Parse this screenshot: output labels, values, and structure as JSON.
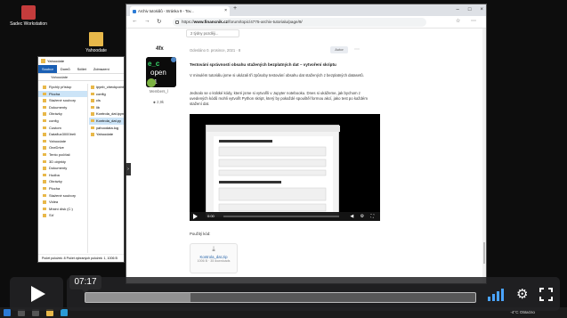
{
  "desktop": {
    "icons": [
      {
        "label": "Sadec Workstation",
        "color": "#c43c3c"
      },
      {
        "label": "Yahoodate",
        "color": "#e8b84a"
      }
    ]
  },
  "explorer": {
    "title": "Yahoodate",
    "ribbon": [
      "Soubor",
      "Domů",
      "Sdílet",
      "Zobrazení"
    ],
    "active_ribbon": "Soubor",
    "address": "Yahoodate",
    "nav": [
      "Rychlý přístup",
      "Plocha",
      "Stažené soubory",
      "Dokumenty",
      "Obrázky",
      "config",
      "Custom",
      "Dataflux3000Ireli",
      "Yahoodate",
      "OneDrive",
      "Tento počítač",
      "3D objekty",
      "Dokumenty",
      "Hudba",
      "Obrázky",
      "Plocha",
      "Stažené soubory",
      "Videa",
      "Místní disk (C:)",
      "Síť"
    ],
    "nav_selected": "Plocha",
    "files": [
      "ipynb_checkpoints",
      "config",
      "cls",
      "lib",
      "Kontrola_dat.ipynb",
      "Kontrola_dat.py",
      "yahoodata.log",
      "Yahoodate"
    ],
    "file_selected": "Kontrola_dat.py",
    "status": "Počet položek: 8   Počet vybraných položek: 1, 1006 B"
  },
  "browser": {
    "tab_title": "Archiv tutoriálů - Stránka 9 - Tov...",
    "url_prefix": "https://",
    "url_domain": "www.financnik.cz",
    "url_rest": "/forum/topic/4775-archiv-tutorialu/page/9/",
    "prev_box": "2 týdny později...",
    "post": {
      "username": "4fx",
      "badge": "Members_l",
      "likes": "2,9k",
      "date": "Odesláno 0. prosince, 2021 · 8",
      "author_tag": "Autor",
      "title": "Testování správnosti obsahu stažených bezplatných dat – vytvoření skriptu",
      "para1": "V minulém tutoriálu jsme si ukázali tři způsoby testování obsahu dat stažených z bezplatných datasetů.",
      "para2": "Jednalo se o krátké kódy, které jsme si vytvořili v Jupyter notebooku. Dnes si ukážeme, jak bychom z uvedených kódů mohli vytvořit Python skript, který by pokaždé spouštěl formou akcí, jako test po každém stažení dat.",
      "video_time": "0:00",
      "video_progress_pct": 0,
      "attach_label": "Použitý kód:",
      "file_name": "Kontrola_dat.zip",
      "file_meta": "1006 B · 35 downloads"
    }
  },
  "taskbar": {
    "tray_text": "-4°C  Oblačno"
  },
  "player": {
    "time": "07:17",
    "progress_pct": 27,
    "volume_bars": 4
  }
}
